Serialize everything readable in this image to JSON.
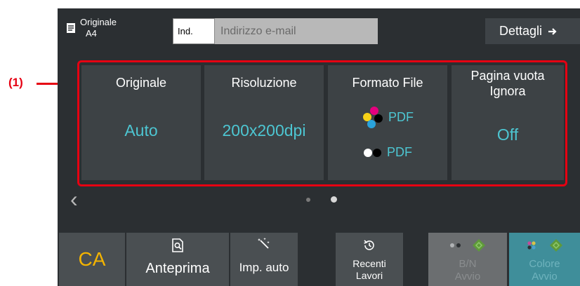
{
  "callout": {
    "label": "(1)"
  },
  "header": {
    "original_label": "Originale",
    "original_size": "A4",
    "address_tag": "Ind.",
    "address_placeholder": "Indirizzo e-mail",
    "details_label": "Dettagli",
    "details_icon": "arrow-right-icon"
  },
  "settings": {
    "original": {
      "title": "Originale",
      "value": "Auto"
    },
    "resolution": {
      "title": "Risoluzione",
      "value": "200x200dpi"
    },
    "file_format": {
      "title": "Formato File",
      "color_value": "PDF",
      "bw_value": "PDF"
    },
    "blank_page": {
      "title_line1": "Pagina vuota",
      "title_line2": "Ignora",
      "value": "Off"
    }
  },
  "pager": {
    "total_pages": 2,
    "current_page": 2
  },
  "footer": {
    "ca_label": "CA",
    "preview_label": "Anteprima",
    "auto_label": "Imp. auto",
    "recent_line1": "Recenti",
    "recent_line2": "Lavori",
    "bw_line1": "B/N",
    "bw_line2": "Avvio",
    "color_line1": "Colore",
    "color_line2": "Avvio"
  },
  "colors": {
    "accent_value": "#4dc6d2",
    "ca_yellow": "#f4b400",
    "callout_red": "#e60012",
    "panel_bg": "#2b2f32",
    "tile_bg": "#3d4245"
  }
}
